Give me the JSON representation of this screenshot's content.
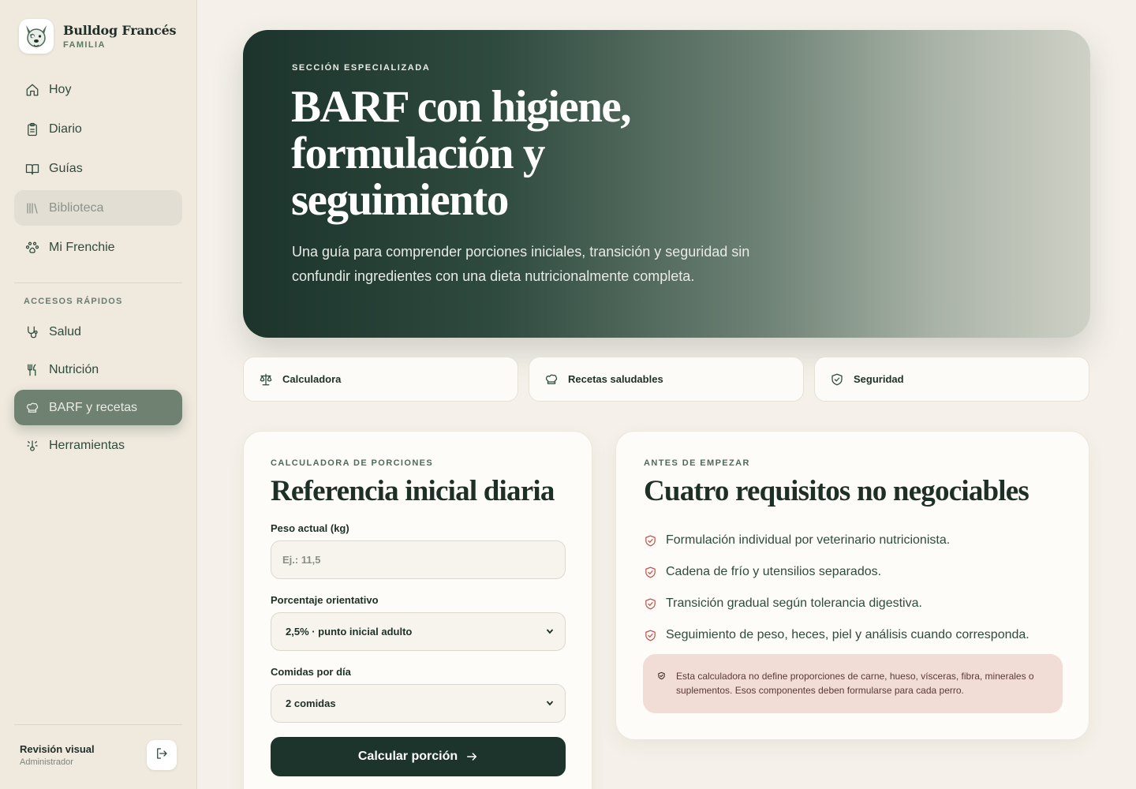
{
  "brand": {
    "title": "Bulldog Francés",
    "subtitle": "FAMILIA",
    "logo_icon": "bulldog-logo-icon"
  },
  "nav_main": [
    {
      "label": "Hoy",
      "icon": "home-icon",
      "state": "normal"
    },
    {
      "label": "Diario",
      "icon": "clipboard-icon",
      "state": "normal"
    },
    {
      "label": "Guías",
      "icon": "book-icon",
      "state": "normal"
    },
    {
      "label": "Biblioteca",
      "icon": "library-icon",
      "state": "hover"
    },
    {
      "label": "Mi Frenchie",
      "icon": "paw-icon",
      "state": "normal"
    }
  ],
  "quick_access": {
    "label": "ACCESOS RÁPIDOS",
    "items": [
      {
        "label": "Salud",
        "icon": "stethoscope-icon",
        "state": "normal"
      },
      {
        "label": "Nutrición",
        "icon": "utensils-icon",
        "state": "normal"
      },
      {
        "label": "BARF y recetas",
        "icon": "chef-hat-icon",
        "state": "active"
      },
      {
        "label": "Herramientas",
        "icon": "thermometer-icon",
        "state": "normal"
      }
    ]
  },
  "user": {
    "name": "Revisión visual",
    "role": "Administrador",
    "logout_icon": "logout-icon"
  },
  "hero": {
    "eyebrow": "SECCIÓN ESPECIALIZADA",
    "title": "BARF con higiene, formulación y seguimiento",
    "description": "Una guía para comprender porciones iniciales, transición y seguridad sin confundir ingredientes con una dieta nutricionalmente completa."
  },
  "tabs": [
    {
      "label": "Calculadora",
      "icon": "scale-icon"
    },
    {
      "label": "Recetas saludables",
      "icon": "chef-hat-icon"
    },
    {
      "label": "Seguridad",
      "icon": "shield-check-icon"
    }
  ],
  "calculator": {
    "eyebrow": "CALCULADORA DE PORCIONES",
    "title": "Referencia inicial diaria",
    "weight_label": "Peso actual (kg)",
    "weight_value": "",
    "weight_placeholder": "Ej.: 11,5",
    "percent_label": "Porcentaje orientativo",
    "percent_value": "2,5% · punto inicial adulto",
    "meals_label": "Comidas por día",
    "meals_value": "2 comidas",
    "button_label": "Calcular porción"
  },
  "requirements": {
    "eyebrow": "ANTES DE EMPEZAR",
    "title": "Cuatro requisitos no negociables",
    "items": [
      "Formulación individual por veterinario nutricionista.",
      "Cadena de frío y utensilios separados.",
      "Transición gradual según tolerancia digestiva.",
      "Seguimiento de peso, heces, piel y análisis cuando corresponda."
    ],
    "warning": "Esta calculadora no define proporciones de carne, hueso, vísceras, fibra, minerales o suplementos. Esos componentes deben formularse para cada perro."
  },
  "colors": {
    "primary": "#1c342c",
    "active_nav": "#6f8170",
    "accent_red": "#c0574c",
    "warning_bg": "#f2dcd6",
    "background": "#f5f1ea"
  }
}
